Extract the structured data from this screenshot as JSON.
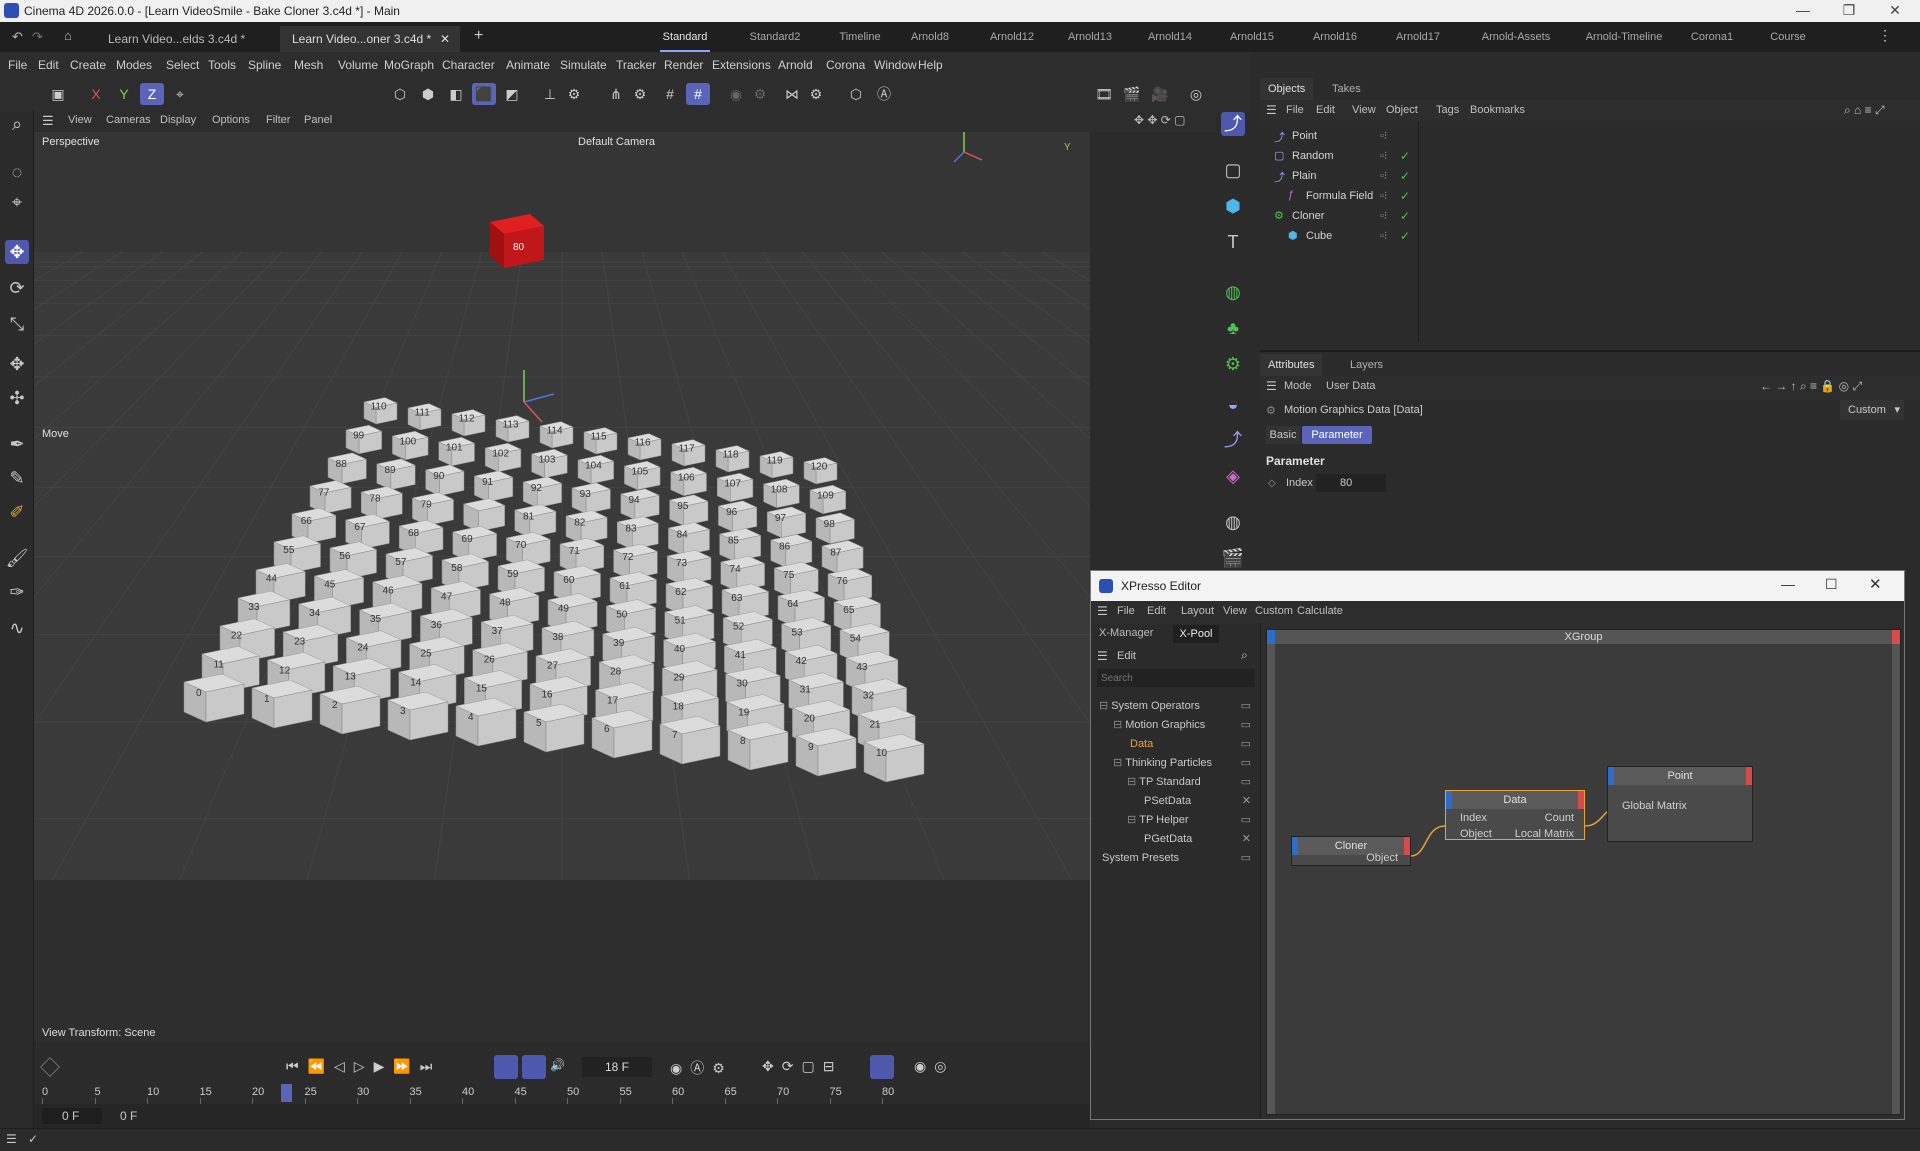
{
  "app": {
    "title": "Cinema 4D 2026.0.0 - [Learn VideoSmile - Bake Cloner 3.c4d *] - Main"
  },
  "doc_tabs": [
    "Learn Video...elds 3.c4d *",
    "Learn Video...oner 3.c4d *"
  ],
  "layout_tabs": [
    "Standard",
    "Standard2",
    "Timeline",
    "Arnold8",
    "Arnold12",
    "Arnold13",
    "Arnold14",
    "Arnold15",
    "Arnold16",
    "Arnold17",
    "Arnold-Assets",
    "Arnold-Timeline",
    "Corona1",
    "Course"
  ],
  "menu": [
    "File",
    "Edit",
    "Create",
    "Modes",
    "Select",
    "Tools",
    "Spline",
    "Mesh",
    "Volume",
    "MoGraph",
    "Character",
    "Animate",
    "Simulate",
    "Tracker",
    "Render",
    "Extensions",
    "Arnold",
    "Corona",
    "Window",
    "Help"
  ],
  "axis_buttons": [
    "X",
    "Y",
    "Z"
  ],
  "viewport": {
    "menu": [
      "View",
      "Cameras",
      "Display",
      "Options",
      "Filter",
      "Panel"
    ],
    "label": "Perspective",
    "camera": "Default Camera",
    "tool_label": "Move",
    "view_transform": "View Transform: Scene",
    "highlight_cube_label": "80",
    "grid_labels": [
      "0",
      "1",
      "2",
      "3",
      "4",
      "5",
      "6",
      "7",
      "8",
      "9",
      "10",
      "11",
      "12",
      "13",
      "14",
      "15",
      "16",
      "17",
      "18",
      "19",
      "20",
      "21",
      "22",
      "23",
      "24",
      "25",
      "26",
      "27",
      "28",
      "29",
      "30",
      "31",
      "32",
      "33",
      "34",
      "35",
      "36",
      "37",
      "38",
      "39",
      "40",
      "41",
      "42",
      "43",
      "44",
      "45",
      "46",
      "47",
      "48",
      "49",
      "50",
      "51",
      "52",
      "53",
      "54",
      "55",
      "56",
      "57",
      "58",
      "59",
      "60",
      "61",
      "62",
      "63",
      "64",
      "65",
      "66",
      "67",
      "68",
      "69",
      "70",
      "71",
      "72",
      "73",
      "74",
      "75",
      "76",
      "77",
      "78",
      "79",
      "81",
      "82",
      "83",
      "84",
      "85",
      "86",
      "87",
      "88",
      "89",
      "90",
      "91",
      "92",
      "93",
      "94",
      "95",
      "96",
      "97",
      "98",
      "99",
      "100",
      "101",
      "102",
      "103",
      "104",
      "105",
      "106",
      "107",
      "108",
      "109",
      "110",
      "111",
      "112",
      "113",
      "114",
      "115",
      "116",
      "117",
      "118",
      "119",
      "120"
    ]
  },
  "timeline": {
    "current_frame": "18 F",
    "ruler_ticks": [
      "0",
      "5",
      "10",
      "15",
      "20",
      "25",
      "30",
      "35",
      "40",
      "45",
      "50",
      "55",
      "60",
      "65",
      "70",
      "75",
      "80"
    ],
    "playhead": "18",
    "start_frame": "0 F",
    "end_frame": "0 F"
  },
  "objects_panel": {
    "tabs": [
      "Objects",
      "Takes"
    ],
    "menu": [
      "File",
      "Edit",
      "View",
      "Object",
      "Tags",
      "Bookmarks"
    ],
    "items": [
      {
        "name": "Point",
        "indent": 0
      },
      {
        "name": "Random",
        "indent": 0
      },
      {
        "name": "Plain",
        "indent": 0
      },
      {
        "name": "Formula Field",
        "indent": 1
      },
      {
        "name": "Cloner",
        "indent": 0
      },
      {
        "name": "Cube",
        "indent": 1
      }
    ]
  },
  "attributes_panel": {
    "tabs": [
      "Attributes",
      "Layers"
    ],
    "menu": [
      "Mode",
      "User Data"
    ],
    "object_title": "Motion Graphics Data [Data]",
    "mode_dropdown": "Custom",
    "sub_tabs": [
      "Basic",
      "Parameter"
    ],
    "section": "Parameter",
    "field_label": "Index",
    "field_value": "80"
  },
  "xpresso": {
    "title": "XPresso Editor",
    "menu": [
      "File",
      "Edit",
      "Layout",
      "View",
      "Custom",
      "Calculate"
    ],
    "left_tabs": [
      "X-Manager",
      "X-Pool"
    ],
    "pool_menu": "Edit",
    "search_placeholder": "Search",
    "tree": [
      {
        "label": "System Operators",
        "level": 0
      },
      {
        "label": "Motion Graphics",
        "level": 1
      },
      {
        "label": "Data",
        "level": 2
      },
      {
        "label": "Thinking Particles",
        "level": 1
      },
      {
        "label": "TP Standard",
        "level": 2
      },
      {
        "label": "PSetData",
        "level": 3
      },
      {
        "label": "TP Helper",
        "level": 2
      },
      {
        "label": "PGetData",
        "level": 3
      },
      {
        "label": "System Presets",
        "level": 0
      }
    ],
    "group_title": "XGroup",
    "nodes": {
      "cloner": {
        "title": "Cloner",
        "out": [
          "Object"
        ]
      },
      "data": {
        "title": "Data",
        "in": [
          "Index",
          "Object"
        ],
        "out": [
          "Count",
          "Local Matrix"
        ]
      },
      "point": {
        "title": "Point",
        "in": [
          "Global Matrix"
        ]
      }
    }
  },
  "colors": {
    "accent": "#5a64b8",
    "highlight_cube": "#c0171a",
    "active_tree": "#e7a33a",
    "check": "#4fc14f"
  }
}
